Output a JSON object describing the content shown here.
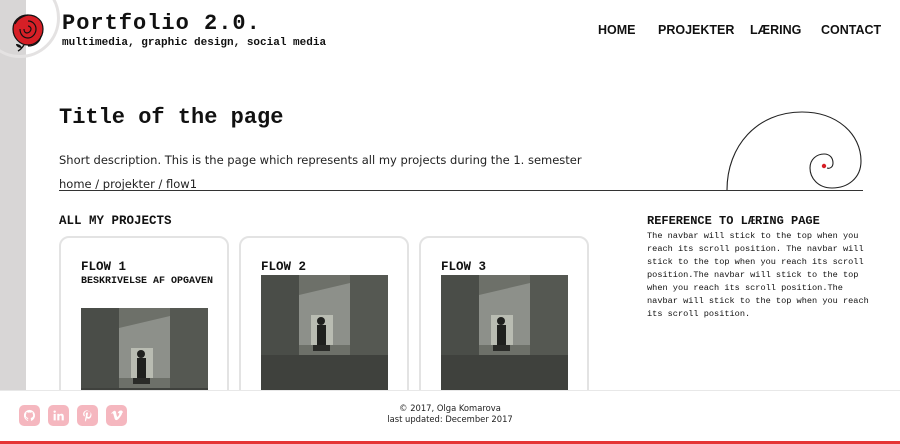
{
  "header": {
    "title": "Portfolio 2.0.",
    "subtitle": "multimedia, graphic design, social media"
  },
  "nav": {
    "items": [
      {
        "label": "HOME"
      },
      {
        "label": "PROJEKTER"
      },
      {
        "label": "LÆRING"
      },
      {
        "label": "CONTACT"
      }
    ]
  },
  "page": {
    "title": "Title of the page",
    "description": "Short description. This is the page which represents all my projects during the 1. semester",
    "breadcrumb": "home / projekter / flow1"
  },
  "projects": {
    "section_title": "ALL MY PROJECTS",
    "cards": [
      {
        "title": "FLOW 1",
        "subtitle": "BESKRIVELSE AF OPGAVEN"
      },
      {
        "title": "FLOW 2",
        "subtitle": ""
      },
      {
        "title": "FLOW 3",
        "subtitle": ""
      }
    ]
  },
  "reference": {
    "title": "REFERENCE TO LÆRING PAGE",
    "body": "The navbar will stick to the top when you reach its scroll position. The navbar will stick to the top when you reach its scroll position.The navbar will stick to the top when you reach its scroll position.The navbar will stick to the top when you reach its scroll position."
  },
  "footer": {
    "copyright": "© 2017, Olga Komarova",
    "updated": "last updated: December 2017",
    "social": [
      "github-icon",
      "linkedin-icon",
      "pinterest-icon",
      "vimeo-icon"
    ]
  },
  "colors": {
    "accent": "#e53535",
    "social_bg": "#f5b7bf",
    "sidebar": "#d8d6d6"
  }
}
